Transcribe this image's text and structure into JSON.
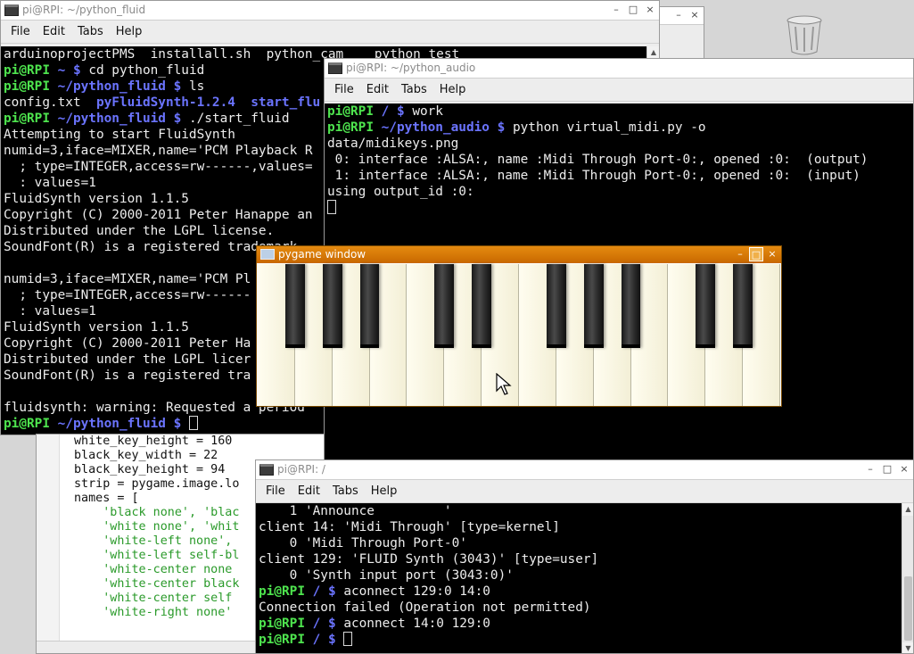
{
  "desktop": {
    "trash_icon": "trash-icon"
  },
  "menus": [
    "File",
    "Edit",
    "Tabs",
    "Help"
  ],
  "window_controls": {
    "minimize": "–",
    "maximize": "□",
    "close": "×"
  },
  "fluid_window": {
    "title": "pi@RPI: ~/python_fluid",
    "lines": [
      [
        {
          "t": "arduinoprojectPMS  installall.sh  python_cam    python_test",
          "c": "w"
        }
      ],
      [
        {
          "t": "pi@RPI ",
          "c": "g"
        },
        {
          "t": "~ $ ",
          "c": "b"
        },
        {
          "t": "cd python_fluid",
          "c": "w"
        }
      ],
      [
        {
          "t": "pi@RPI ",
          "c": "g"
        },
        {
          "t": "~/python_fluid $ ",
          "c": "b"
        },
        {
          "t": "ls",
          "c": "w"
        }
      ],
      [
        {
          "t": "config.txt  ",
          "c": "w"
        },
        {
          "t": "pyFluidSynth-1.2.4  start_flu",
          "c": "b"
        }
      ],
      [
        {
          "t": "pi@RPI ",
          "c": "g"
        },
        {
          "t": "~/python_fluid $ ",
          "c": "b"
        },
        {
          "t": "./start_fluid",
          "c": "w"
        }
      ],
      [
        {
          "t": "Attempting to start FluidSynth",
          "c": "w"
        }
      ],
      [
        {
          "t": "numid=3,iface=MIXER,name='PCM Playback R",
          "c": "w"
        }
      ],
      [
        {
          "t": "  ; type=INTEGER,access=rw------,values=",
          "c": "w"
        }
      ],
      [
        {
          "t": "  : values=1",
          "c": "w"
        }
      ],
      [
        {
          "t": "FluidSynth version 1.1.5",
          "c": "w"
        }
      ],
      [
        {
          "t": "Copyright (C) 2000-2011 Peter Hanappe an",
          "c": "w"
        }
      ],
      [
        {
          "t": "Distributed under the LGPL license.",
          "c": "w"
        }
      ],
      [
        {
          "t": "SoundFont(R) is a registered trademark",
          "c": "w"
        }
      ],
      [
        {
          "t": "",
          "c": "w"
        }
      ],
      [
        {
          "t": "numid=3,iface=MIXER,name='PCM Pl",
          "c": "w"
        }
      ],
      [
        {
          "t": "  ; type=INTEGER,access=rw------",
          "c": "w"
        }
      ],
      [
        {
          "t": "  : values=1",
          "c": "w"
        }
      ],
      [
        {
          "t": "FluidSynth version 1.1.5",
          "c": "w"
        }
      ],
      [
        {
          "t": "Copyright (C) 2000-2011 Peter Ha",
          "c": "w"
        }
      ],
      [
        {
          "t": "Distributed under the LGPL licer",
          "c": "w"
        }
      ],
      [
        {
          "t": "SoundFont(R) is a registered tra",
          "c": "w"
        }
      ],
      [
        {
          "t": "",
          "c": "w"
        }
      ],
      [
        {
          "t": "fluidsynth: warning: Requested a period",
          "c": "w"
        }
      ],
      [
        {
          "t": "pi@RPI ",
          "c": "g"
        },
        {
          "t": "~/python_fluid $ ",
          "c": "b"
        },
        {
          "t": "",
          "c": "cursor"
        }
      ]
    ]
  },
  "audio_window": {
    "title": "pi@RPI: ~/python_audio",
    "lines": [
      [
        {
          "t": "pi@RPI ",
          "c": "g"
        },
        {
          "t": "/ $ ",
          "c": "b"
        },
        {
          "t": "work",
          "c": "w"
        }
      ],
      [
        {
          "t": "pi@RPI ",
          "c": "g"
        },
        {
          "t": "~/python_audio $ ",
          "c": "b"
        },
        {
          "t": "python virtual_midi.py -o",
          "c": "w"
        }
      ],
      [
        {
          "t": "data/midikeys.png",
          "c": "w"
        }
      ],
      [
        {
          "t": " 0: interface :ALSA:, name :Midi Through Port-0:, opened :0:  (output)",
          "c": "w"
        }
      ],
      [
        {
          "t": " 1: interface :ALSA:, name :Midi Through Port-0:, opened :0:  (input)",
          "c": "w"
        }
      ],
      [
        {
          "t": "using output_id :0:",
          "c": "w"
        }
      ],
      [
        {
          "t": "",
          "c": "cursor"
        }
      ]
    ]
  },
  "pygame_window": {
    "title": "pygame window"
  },
  "root_window": {
    "title": "pi@RPI: /",
    "lines": [
      [
        {
          "t": "    1 'Announce         '",
          "c": "w"
        }
      ],
      [
        {
          "t": "client 14: 'Midi Through' [type=kernel]",
          "c": "w"
        }
      ],
      [
        {
          "t": "    0 'Midi Through Port-0'",
          "c": "w"
        }
      ],
      [
        {
          "t": "client 129: 'FLUID Synth (3043)' [type=user]",
          "c": "w"
        }
      ],
      [
        {
          "t": "    0 'Synth input port (3043:0)'",
          "c": "w"
        }
      ],
      [
        {
          "t": "pi@RPI ",
          "c": "g"
        },
        {
          "t": "/ $ ",
          "c": "b"
        },
        {
          "t": "aconnect 129:0 14:0",
          "c": "w"
        }
      ],
      [
        {
          "t": "Connection failed (Operation not permitted)",
          "c": "w"
        }
      ],
      [
        {
          "t": "pi@RPI ",
          "c": "g"
        },
        {
          "t": "/ $ ",
          "c": "b"
        },
        {
          "t": "aconnect 14:0 129:0",
          "c": "w"
        }
      ],
      [
        {
          "t": "pi@RPI ",
          "c": "g"
        },
        {
          "t": "/ $ ",
          "c": "b"
        },
        {
          "t": "",
          "c": "cursor"
        }
      ]
    ]
  },
  "editor": {
    "lines": [
      [
        {
          "t": "white_key_height = 160",
          "c": "n"
        }
      ],
      [
        {
          "t": "black_key_width = 22",
          "c": "n"
        }
      ],
      [
        {
          "t": "black_key_height = 94",
          "c": "n"
        }
      ],
      [
        {
          "t": "strip = pygame.image.lo",
          "c": "n"
        }
      ],
      [
        {
          "t": "names = [",
          "c": "n"
        }
      ],
      [
        {
          "t": "    'black none', 'blac",
          "c": "s"
        }
      ],
      [
        {
          "t": "    'white none', 'whit",
          "c": "s"
        }
      ],
      [
        {
          "t": "    'white-left none',",
          "c": "s"
        }
      ],
      [
        {
          "t": "    'white-left self-bl",
          "c": "s"
        }
      ],
      [
        {
          "t": "    'white-center none",
          "c": "s"
        }
      ],
      [
        {
          "t": "    'white-center black",
          "c": "s"
        }
      ],
      [
        {
          "t": "    'white-center self",
          "c": "s"
        }
      ],
      [
        {
          "t": "    'white-right none'",
          "c": "s"
        }
      ]
    ]
  },
  "piano": {
    "white_key_count": 14,
    "black_key_positions": [
      1,
      2,
      3,
      5,
      6,
      8,
      9,
      10,
      12,
      13
    ]
  }
}
